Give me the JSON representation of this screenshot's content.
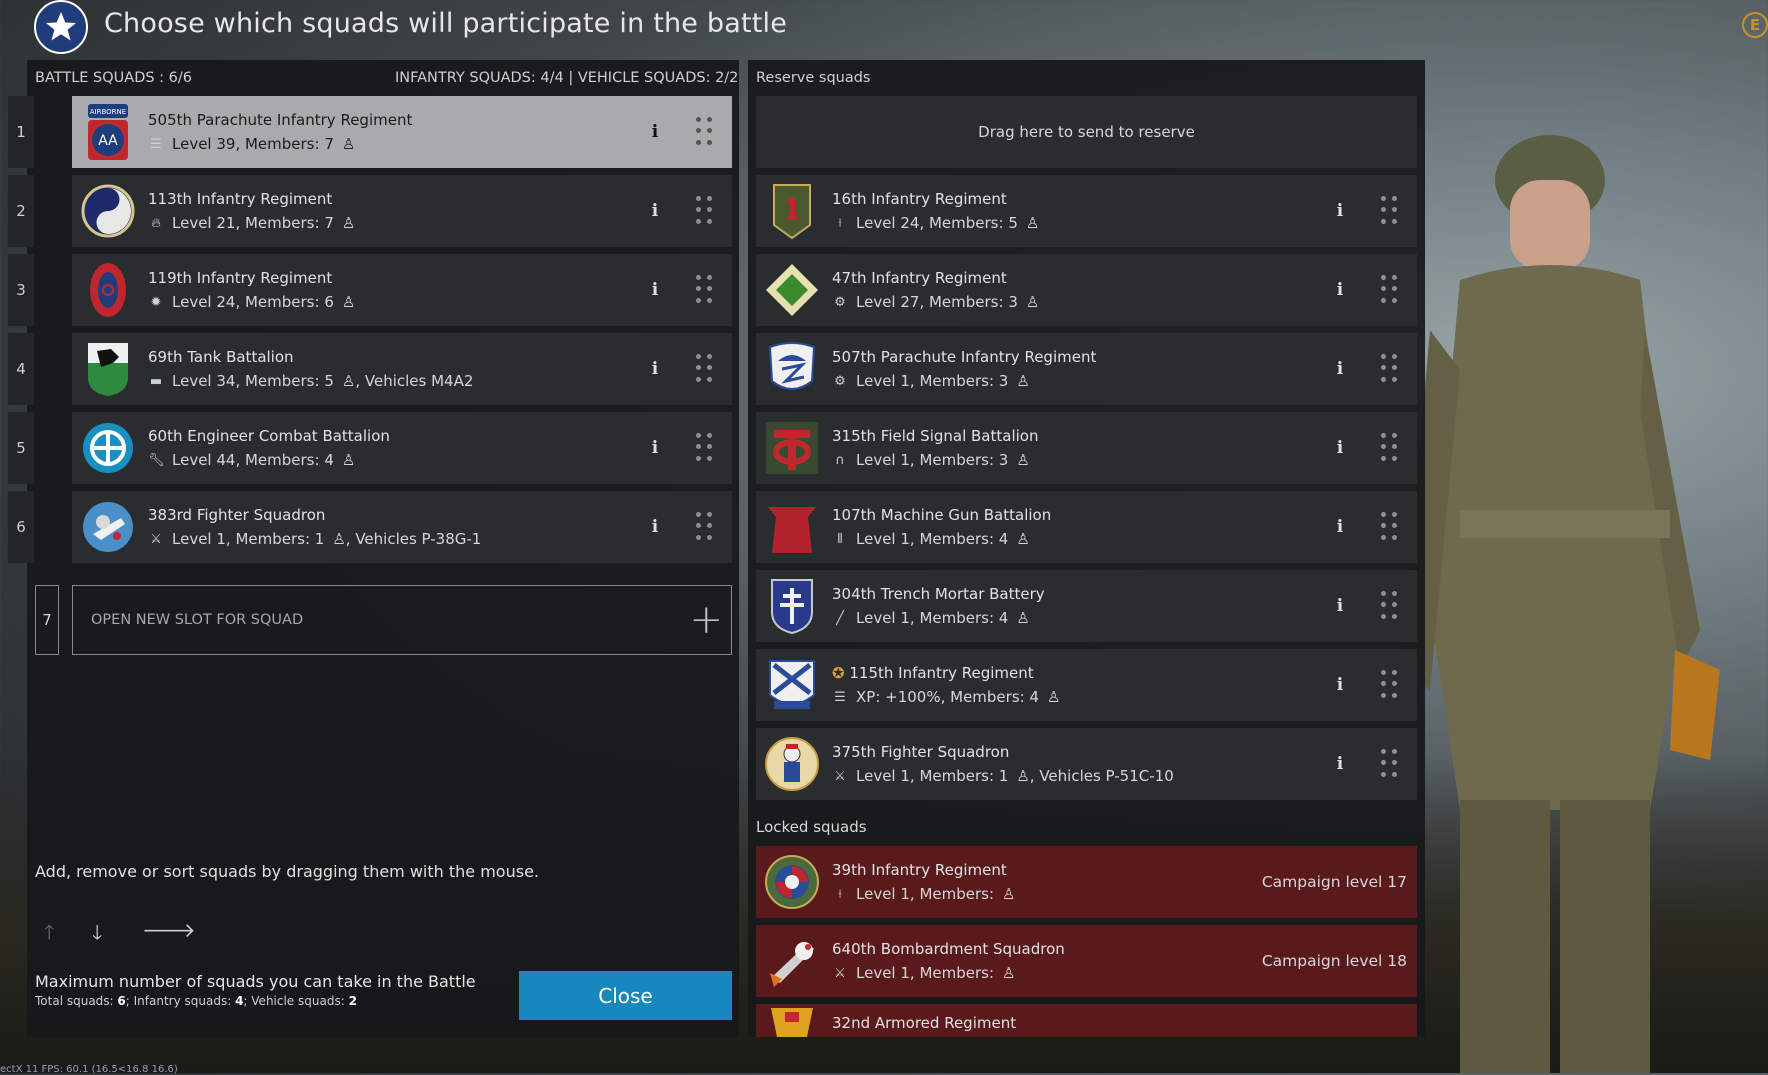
{
  "header": {
    "title": "Choose which squads will participate in the battle",
    "currency_symbol": "E"
  },
  "battle": {
    "title": "BATTLE SQUADS : 6/6",
    "counts": "INFANTRY SQUADS: 4/4 | VEHICLE SQUADS: 2/2",
    "squads": [
      {
        "num": "1",
        "name": "505th Parachute Infantry Regiment",
        "meta": "Level 39, Members: 7",
        "icon": "list-icon",
        "selected": true
      },
      {
        "num": "2",
        "name": "113th Infantry Regiment",
        "meta": "Level 21, Members: 7",
        "icon": "flame-icon"
      },
      {
        "num": "3",
        "name": "119th Infantry Regiment",
        "meta": "Level 24, Members: 6",
        "icon": "explosion-icon"
      },
      {
        "num": "4",
        "name": "69th Tank Battalion",
        "meta": "Level 34, Members: 5",
        "extra": ", Vehicles M4A2",
        "icon": "tank-icon"
      },
      {
        "num": "5",
        "name": "60th Engineer Combat Battalion",
        "meta": "Level 44, Members: 4",
        "icon": "wrench-icon"
      },
      {
        "num": "6",
        "name": "383rd Fighter Squadron",
        "meta": "Level 1, Members: 1",
        "extra": ", Vehicles P-38G-1",
        "icon": "crossed-swords-icon"
      }
    ],
    "open_slot_num": "7",
    "open_slot_label": "OPEN NEW SLOT FOR SQUAD",
    "hint": "Add, remove or sort squads by dragging them with the mouse.",
    "max_label": "Maximum number of squads you can take in the Battle",
    "max_sub": {
      "total_label": "Total squads: ",
      "total": "6",
      "inf_label": "; Infantry squads: ",
      "inf": "4",
      "veh_label": "; Vehicle squads: ",
      "veh": "2"
    },
    "close_label": "Close"
  },
  "reserve": {
    "title": "Reserve squads",
    "drop_label": "Drag here to send to reserve",
    "squads": [
      {
        "name": "16th Infantry Regiment",
        "meta": "Level 24, Members: 5",
        "icon": "rifle-icon"
      },
      {
        "name": "47th Infantry Regiment",
        "meta": "Level 27, Members: 3",
        "icon": "gear-icon"
      },
      {
        "name": "507th Parachute Infantry Regiment",
        "meta": "Level 1, Members: 3",
        "icon": "gear-icon"
      },
      {
        "name": "315th Field Signal Battalion",
        "meta": "Level 1, Members: 3",
        "icon": "headphones-icon"
      },
      {
        "name": "107th Machine Gun Battalion",
        "meta": "Level 1, Members: 4",
        "icon": "ammo-icon"
      },
      {
        "name": "304th Trench Mortar Battery",
        "meta": "Level 1, Members: 4",
        "icon": "mortar-icon"
      },
      {
        "name": "115th Infantry Regiment",
        "meta": "XP: +100%, Members: 4",
        "icon": "list-icon",
        "premium": true
      },
      {
        "name": "375th Fighter Squadron",
        "meta": "Level 1, Members: 1",
        "extra": ", Vehicles P-51C-10",
        "icon": "crossed-swords-icon"
      }
    ]
  },
  "locked": {
    "title": "Locked squads",
    "squads": [
      {
        "name": "39th Infantry Regiment",
        "meta": "Level 1, Members: ",
        "campaign": "Campaign level 17",
        "icon": "rifle-icon"
      },
      {
        "name": "640th Bombardment Squadron",
        "meta": "Level 1, Members: ",
        "campaign": "Campaign level 18",
        "icon": "crossed-swords-icon"
      },
      {
        "name": "32nd Armored Regiment",
        "meta": "",
        "campaign": "",
        "icon": "tank-icon"
      }
    ]
  },
  "debug_text": "ectX 11 FPS: 60.1 (16.5<16.8 16.6)"
}
